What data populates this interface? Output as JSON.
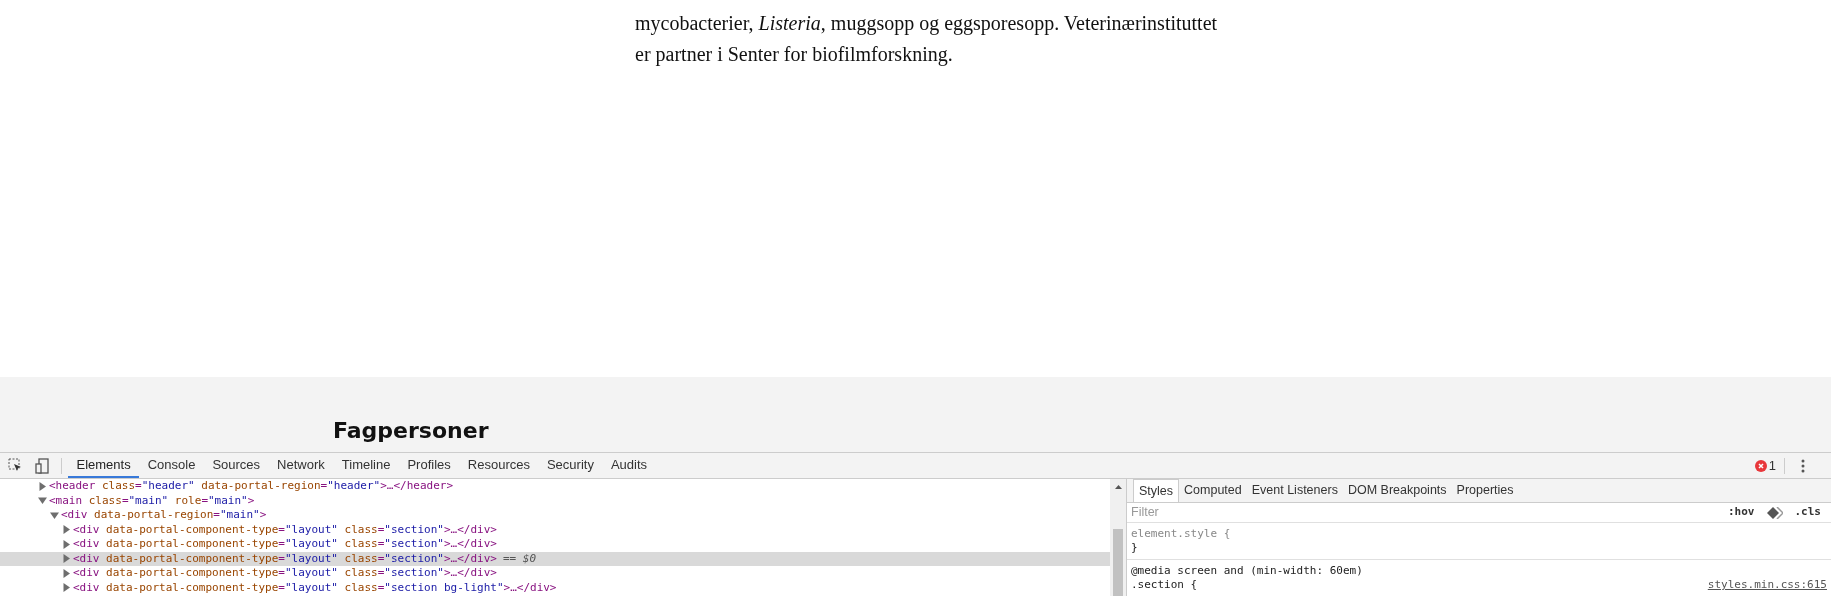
{
  "article": {
    "lines": [
      "mycobacterier, *Listeria*, muggsopp og eggsporesopp. Veterinærinstituttet",
      "er partner i Senter for biofilmforskning."
    ]
  },
  "section": {
    "heading": "Fagpersoner"
  },
  "devtools": {
    "tabs": [
      {
        "label": "Elements",
        "selected": true
      },
      {
        "label": "Console",
        "selected": false
      },
      {
        "label": "Sources",
        "selected": false
      },
      {
        "label": "Network",
        "selected": false
      },
      {
        "label": "Timeline",
        "selected": false
      },
      {
        "label": "Profiles",
        "selected": false
      },
      {
        "label": "Resources",
        "selected": false
      },
      {
        "label": "Security",
        "selected": false
      },
      {
        "label": "Audits",
        "selected": false
      }
    ],
    "error_count": "1",
    "tree": [
      {
        "text": "<header class=\"header\" data-portal-region=\"header\">…</header>",
        "expanded": false,
        "selected": false
      },
      {
        "text": "<main class=\"main\" role=\"main\">",
        "expanded": true,
        "selected": false,
        "children": [
          {
            "text": "<div data-portal-region=\"main\">",
            "expanded": true,
            "selected": false,
            "children": [
              {
                "text": "<div data-portal-component-type=\"layout\" class=\"section\">…</div>",
                "expanded": false,
                "selected": false
              },
              {
                "text": "<div data-portal-component-type=\"layout\" class=\"section\">…</div>",
                "expanded": false,
                "selected": false
              },
              {
                "text": "<div data-portal-component-type=\"layout\" class=\"section\">…</div>",
                "expanded": false,
                "selected": true,
                "marker": "== $0"
              },
              {
                "text": "<div data-portal-component-type=\"layout\" class=\"section\">…</div>",
                "expanded": false,
                "selected": false
              },
              {
                "text": "<div data-portal-component-type=\"layout\" class=\"section bg-light\">…</div>",
                "expanded": false,
                "selected": false
              }
            ]
          }
        ]
      }
    ],
    "styles": {
      "tabs": [
        {
          "label": "Styles",
          "selected": true
        },
        {
          "label": "Computed",
          "selected": false
        },
        {
          "label": "Event Listeners",
          "selected": false
        },
        {
          "label": "DOM Breakpoints",
          "selected": false
        },
        {
          "label": "Properties",
          "selected": false
        }
      ],
      "filter": {
        "placeholder": "Filter"
      },
      "hov": ":hov",
      "cls": ".cls",
      "rules": [
        {
          "selector": "element.style {",
          "close": "}"
        },
        {
          "media": "@media screen and (min-width: 60em)",
          "selector": ".section {",
          "source": "styles.min.css:615"
        }
      ]
    }
  }
}
